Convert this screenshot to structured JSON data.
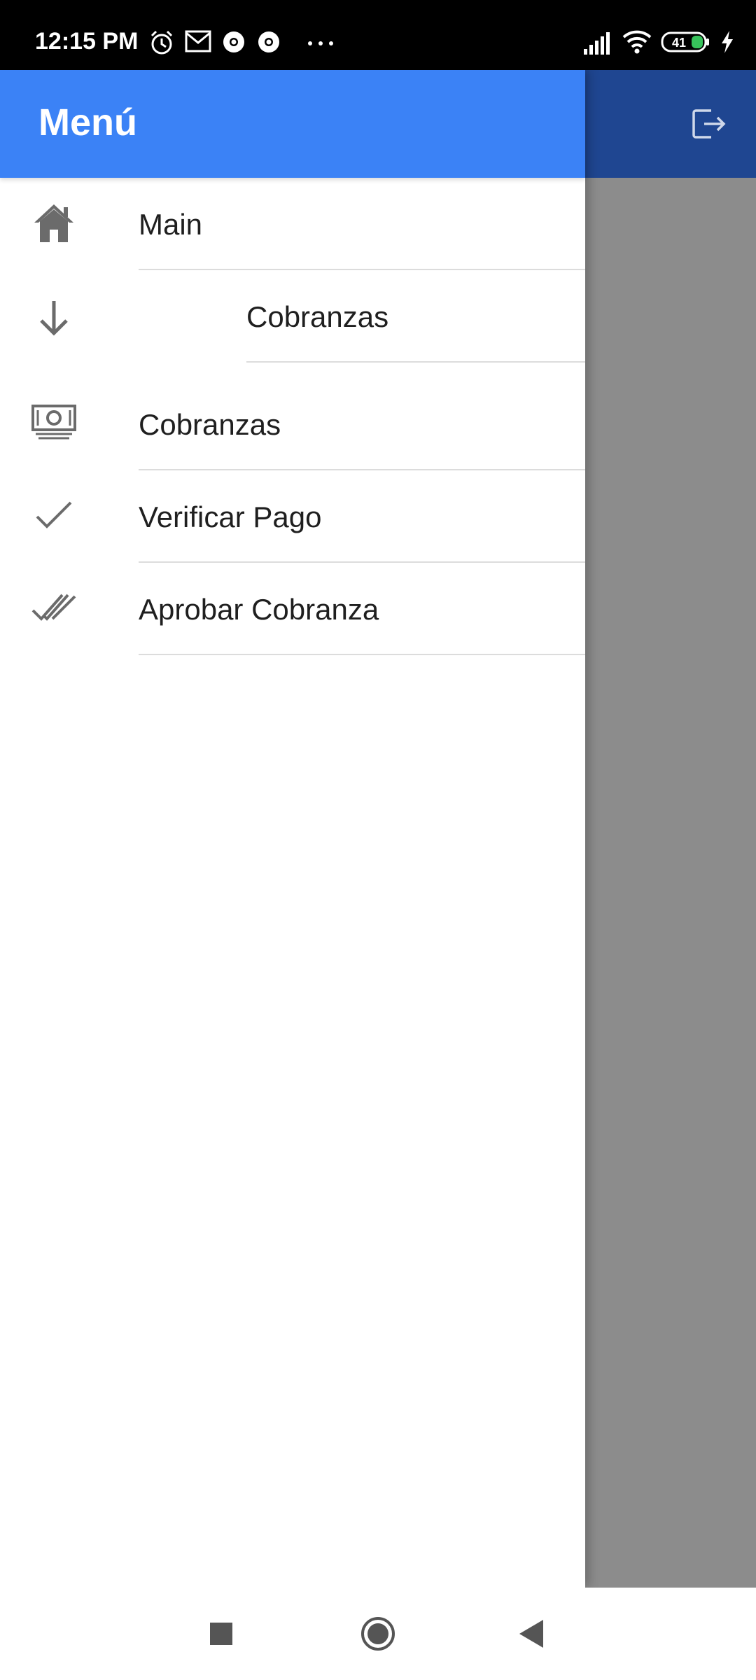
{
  "status_bar": {
    "time": "12:15 PM",
    "battery_level": "41",
    "icons_left": [
      "alarm-icon",
      "gmail-icon",
      "chrome-icon",
      "chrome-icon",
      "more-dots-icon"
    ],
    "icons_right": [
      "signal-icon",
      "wifi-icon",
      "battery-icon",
      "charging-icon"
    ]
  },
  "drawer": {
    "title": "Menú",
    "items": [
      {
        "label": "Main",
        "icon": "home-icon"
      },
      {
        "label": "Cobranzas",
        "icon": "arrow-down-icon",
        "nested": true
      },
      {
        "label": "Cobranzas",
        "icon": "money-icon"
      },
      {
        "label": "Verificar Pago",
        "icon": "check-icon"
      },
      {
        "label": "Aprobar Cobranza",
        "icon": "double-check-icon"
      }
    ]
  },
  "app_bar": {
    "action_icon": "logout-icon"
  },
  "nav_bar": {
    "buttons": [
      "recents-square-icon",
      "home-circle-icon",
      "back-triangle-icon"
    ]
  },
  "colors": {
    "drawer_header": "#3b82f6",
    "app_bar_behind_scrim": "#2b5fc4",
    "icon_gray": "#6b6b6b",
    "status_bar": "#000000"
  }
}
